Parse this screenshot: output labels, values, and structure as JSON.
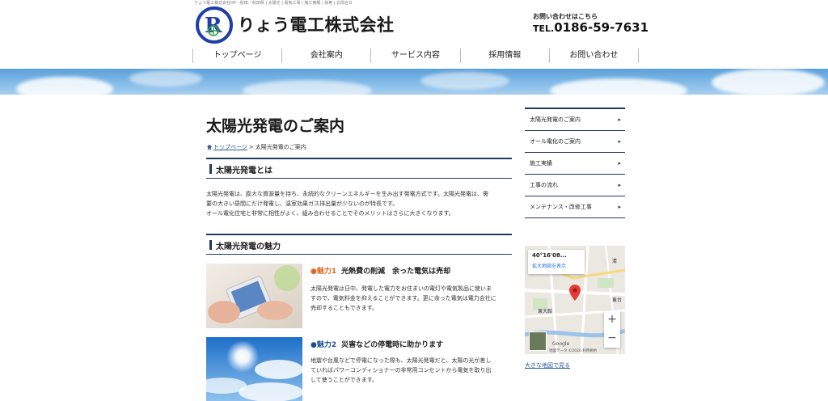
{
  "topline": "りょう電工株式会社HP・秋田／秋田県 | 太陽光 | 電気工事 | 施工実績 | 採用 | お問合せ",
  "header": {
    "company_name": "りょう電工株式会社",
    "contact_caption": "お問い合わせはこちら",
    "tel_prefix": "TEL.",
    "tel_number": "0186-59-7631"
  },
  "nav": [
    "トップページ",
    "会社案内",
    "サービス内容",
    "採用情報",
    "お問い合わせ"
  ],
  "main": {
    "title": "太陽光発電のご案内",
    "breadcrumb_home": "トップページ",
    "breadcrumb_sep": ">",
    "breadcrumb_current": "太陽光発電のご案内",
    "section1_title": "太陽光発電とは",
    "section1_lines": [
      "太陽光発電は、膨大な資源量を持ち、永続的なクリーンエネルギーを生み出す発電方式です。太陽光発電は、需",
      "要の大きい昼間にだけ発電し、温室効果ガス排出量が少ないのが特長です。",
      "オール電化住宅と非常に相性がよく、組み合わせることでそのメリットはさらに大きくなります。"
    ],
    "section2_title": "太陽光発電の魅力",
    "features": [
      {
        "label": "魅力1",
        "title": "光熱費の削減　余った電気は売却",
        "desc_lines": [
          "太陽光発電は日中、発電した電力をお住まいの電灯や電気製品に使いま",
          "すので、電気料金を抑えることができます。更に余った電気は電力会社に",
          "売却することもできます。"
        ]
      },
      {
        "label": "魅力2",
        "title": "災害などの停電時に助かります",
        "desc_lines": [
          "地震や台風などで停電になった際も、太陽光発電だと、太陽の光が差し",
          "ていればパワーコンディショナーの非常用コンセントから電気を取り出",
          "して使うことができます。"
        ]
      }
    ]
  },
  "sidebar": {
    "items": [
      "太陽光発電のご案内",
      "オール電化のご案内",
      "施工実績",
      "工事の流れ",
      "メンテナンス・改修工事"
    ],
    "chevron": "▸"
  },
  "map": {
    "coord": "40°16'08...",
    "enlarge": "拡大地図を表示",
    "zoom_in": "+",
    "zoom_out": "−",
    "google": "Google",
    "footer": "地図データ ©2026 利用規約",
    "label_east": "東大館",
    "label_a": "東台",
    "label_b": "清",
    "big_map_link": "大きな地図で見る"
  },
  "colors": {
    "navy": "#1f3a5f",
    "accent_orange": "#e8641e",
    "accent_blue": "#1f4f8f",
    "link": "#2a5aa0"
  }
}
